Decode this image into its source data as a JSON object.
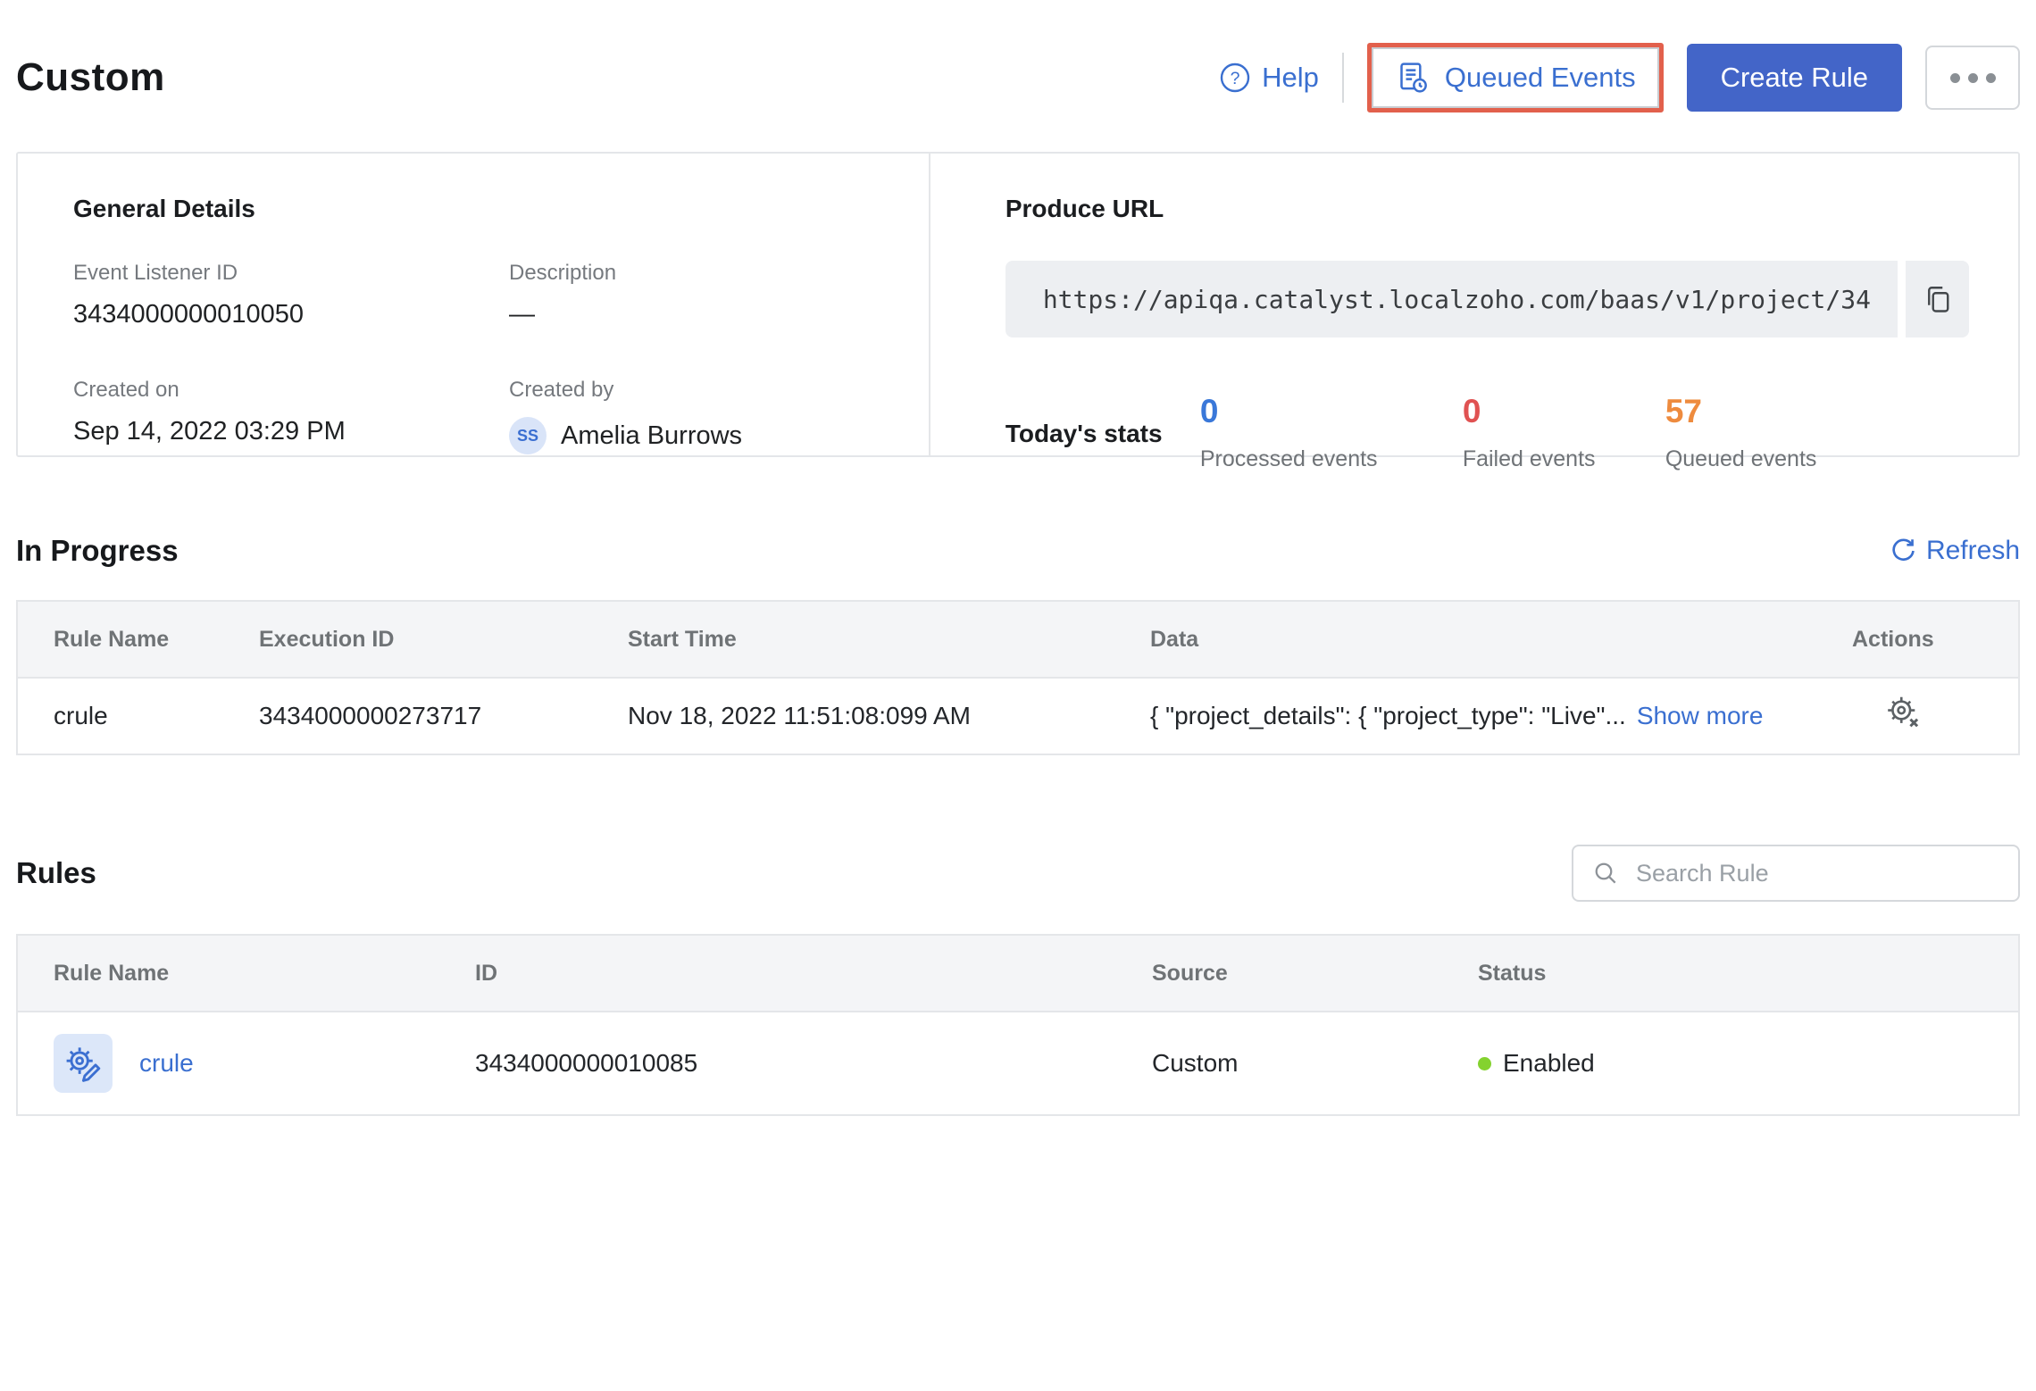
{
  "title": "Custom",
  "colors": {
    "accent_blue": "#3a6fd0",
    "primary_button_blue": "#4365c8",
    "highlight_red_outline": "#e2604c",
    "status_green": "#84d22f"
  },
  "toolbar": {
    "help": "Help",
    "queued_events": "Queued Events",
    "create_rule": "Create Rule"
  },
  "general_details": {
    "heading": "General Details",
    "event_listener_id_label": "Event Listener ID",
    "event_listener_id": "3434000000010050",
    "description_label": "Description",
    "description": "—",
    "created_on_label": "Created on",
    "created_on": "Sep 14, 2022 03:29 PM",
    "created_by_label": "Created by",
    "created_by": "Amelia Burrows",
    "avatar_initials": "SS"
  },
  "produce_url": {
    "heading": "Produce URL",
    "url": "https://apiqa.catalyst.localzoho.com/baas/v1/project/34"
  },
  "todays_stats": {
    "heading": "Today's stats",
    "stats": [
      {
        "value": "0",
        "label": "Processed events",
        "color": "#3a78d9"
      },
      {
        "value": "0",
        "label": "Failed events",
        "color": "#e05252"
      },
      {
        "value": "57",
        "label": "Queued events",
        "color": "#ee8b3e"
      }
    ]
  },
  "in_progress": {
    "heading": "In Progress",
    "refresh": "Refresh",
    "columns": [
      "Rule Name",
      "Execution ID",
      "Start Time",
      "Data",
      "Actions"
    ],
    "row": {
      "rule_name": "crule",
      "execution_id": "3434000000273717",
      "start_time": "Nov 18, 2022 11:51:08:099 AM",
      "data_preview": "{ \"project_details\": { \"project_type\": \"Live\"...",
      "show_more": "Show more"
    }
  },
  "rules": {
    "heading": "Rules",
    "search_placeholder": "Search Rule",
    "columns": [
      "Rule Name",
      "ID",
      "Source",
      "Status"
    ],
    "row": {
      "rule_name": "crule",
      "id": "3434000000010085",
      "source": "Custom",
      "status": "Enabled"
    }
  }
}
